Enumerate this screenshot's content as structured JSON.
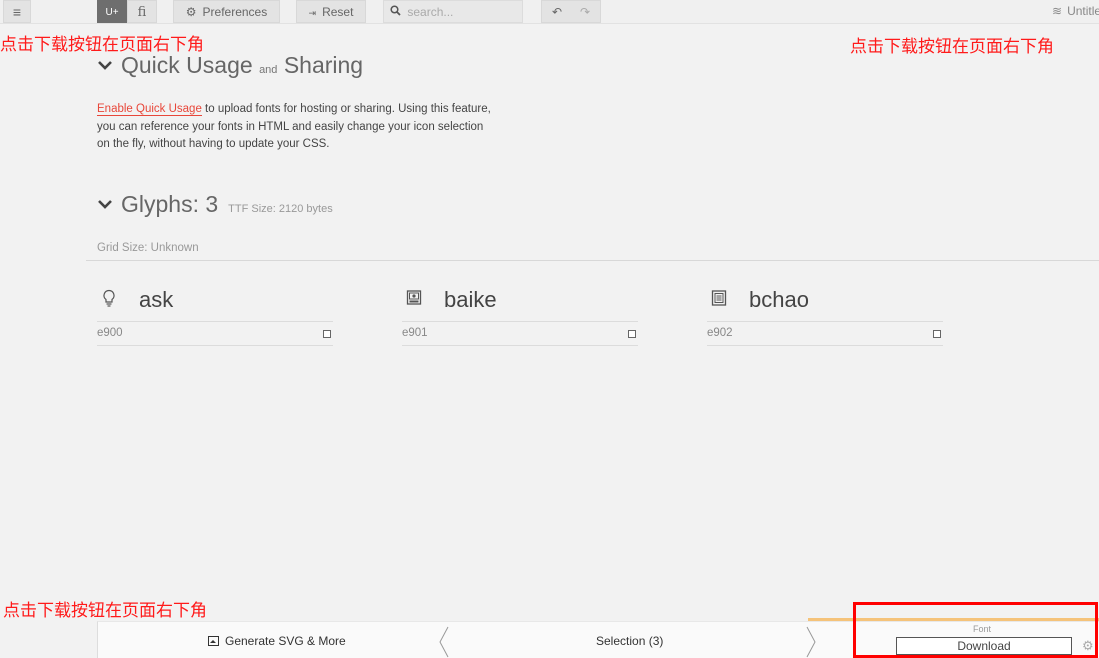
{
  "toolbar": {
    "menu_icon": "≡",
    "uplus_label": "U+",
    "liga_label": "fi",
    "preferences_label": "Preferences",
    "reset_label": "Reset",
    "search_placeholder": "search...",
    "project_name": "Untitled Project"
  },
  "annotations": {
    "top_left": "点击下载按钮在页面右下角",
    "top_right": "点击下载按钮在页面右下角",
    "bottom_left": "点击下载按钮在页面右下角"
  },
  "quick_usage": {
    "title_part1": "Quick Usage",
    "title_and": "and",
    "title_part2": "Sharing",
    "link_text": "Enable Quick Usage",
    "text_line1": " to upload fonts for hosting or sharing. Using this feature,",
    "text_line2": "you can reference your fonts in HTML and easily change your icon selection",
    "text_line3": "on the fly, without having to update your CSS."
  },
  "glyphs": {
    "title": "Glyphs: 3",
    "ttf_size": "TTF Size: 2120 bytes",
    "grid_size": "Grid Size: Unknown",
    "items": [
      {
        "name": "ask",
        "code": "e900",
        "icon": "lightbulb-icon"
      },
      {
        "name": "baike",
        "code": "e901",
        "icon": "picture-icon"
      },
      {
        "name": "bchao",
        "code": "e902",
        "icon": "document-icon"
      }
    ]
  },
  "bottombar": {
    "generate_label": "Generate SVG & More",
    "selection_label": "Selection (3)",
    "font_label": "Font",
    "download_label": "Download"
  },
  "colors": {
    "accent_red": "#e8473a",
    "annotation_red": "#ff0000",
    "font_tab_orange": "#f5c37a"
  }
}
